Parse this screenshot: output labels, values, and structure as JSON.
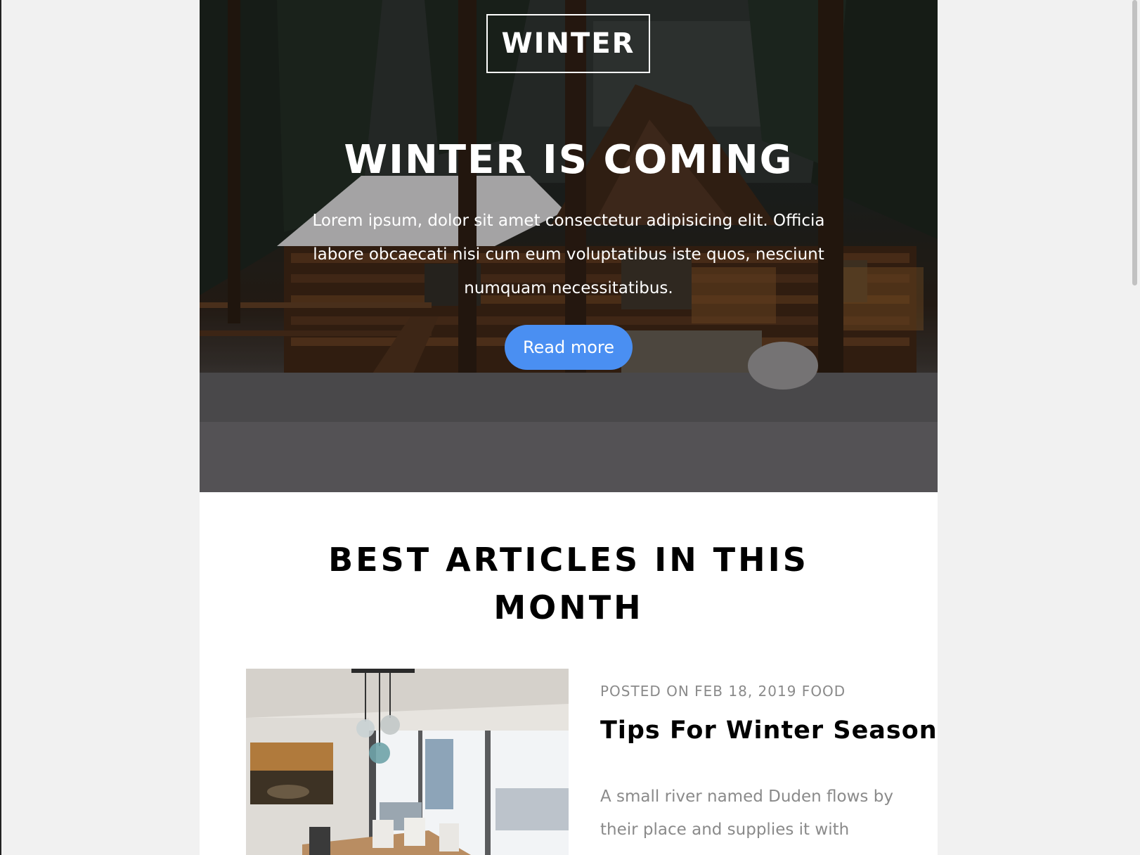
{
  "hero": {
    "logo": "WINTER",
    "title": "WINTER IS COMING",
    "text": "Lorem ipsum, dolor sit amet consectetur adipisicing elit. Officia labore obcaecati nisi cum eum voluptatibus iste quos, nesciunt numquam necessitatibus.",
    "button_label": "Read more"
  },
  "section": {
    "title": "BEST ARTICLES IN THIS MONTH"
  },
  "article": {
    "meta": "POSTED ON FEB 18, 2019 FOOD",
    "title": "Tips For Winter Season",
    "excerpt": "A small river named Duden flows by their place and supplies it with"
  },
  "colors": {
    "button": "#4a8ff2",
    "page_background": "#f1f1f1",
    "meta_text": "#8a8a8a"
  }
}
